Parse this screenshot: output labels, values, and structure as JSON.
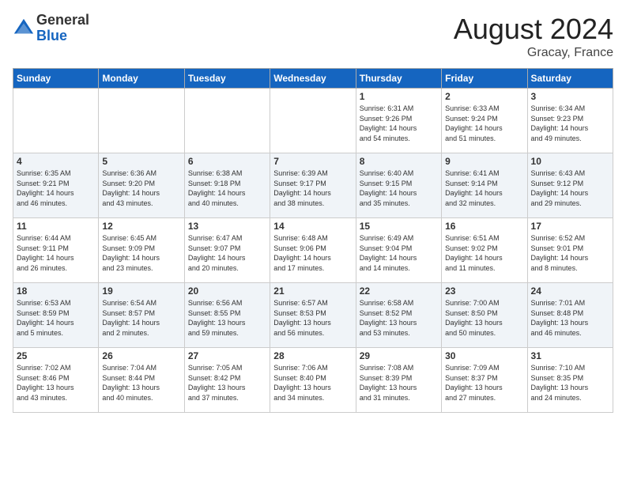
{
  "header": {
    "logo_general": "General",
    "logo_blue": "Blue",
    "month_title": "August 2024",
    "location": "Gracay, France"
  },
  "days_of_week": [
    "Sunday",
    "Monday",
    "Tuesday",
    "Wednesday",
    "Thursday",
    "Friday",
    "Saturday"
  ],
  "weeks": [
    {
      "days": [
        {
          "num": "",
          "info": ""
        },
        {
          "num": "",
          "info": ""
        },
        {
          "num": "",
          "info": ""
        },
        {
          "num": "",
          "info": ""
        },
        {
          "num": "1",
          "info": "Sunrise: 6:31 AM\nSunset: 9:26 PM\nDaylight: 14 hours\nand 54 minutes."
        },
        {
          "num": "2",
          "info": "Sunrise: 6:33 AM\nSunset: 9:24 PM\nDaylight: 14 hours\nand 51 minutes."
        },
        {
          "num": "3",
          "info": "Sunrise: 6:34 AM\nSunset: 9:23 PM\nDaylight: 14 hours\nand 49 minutes."
        }
      ]
    },
    {
      "days": [
        {
          "num": "4",
          "info": "Sunrise: 6:35 AM\nSunset: 9:21 PM\nDaylight: 14 hours\nand 46 minutes."
        },
        {
          "num": "5",
          "info": "Sunrise: 6:36 AM\nSunset: 9:20 PM\nDaylight: 14 hours\nand 43 minutes."
        },
        {
          "num": "6",
          "info": "Sunrise: 6:38 AM\nSunset: 9:18 PM\nDaylight: 14 hours\nand 40 minutes."
        },
        {
          "num": "7",
          "info": "Sunrise: 6:39 AM\nSunset: 9:17 PM\nDaylight: 14 hours\nand 38 minutes."
        },
        {
          "num": "8",
          "info": "Sunrise: 6:40 AM\nSunset: 9:15 PM\nDaylight: 14 hours\nand 35 minutes."
        },
        {
          "num": "9",
          "info": "Sunrise: 6:41 AM\nSunset: 9:14 PM\nDaylight: 14 hours\nand 32 minutes."
        },
        {
          "num": "10",
          "info": "Sunrise: 6:43 AM\nSunset: 9:12 PM\nDaylight: 14 hours\nand 29 minutes."
        }
      ]
    },
    {
      "days": [
        {
          "num": "11",
          "info": "Sunrise: 6:44 AM\nSunset: 9:11 PM\nDaylight: 14 hours\nand 26 minutes."
        },
        {
          "num": "12",
          "info": "Sunrise: 6:45 AM\nSunset: 9:09 PM\nDaylight: 14 hours\nand 23 minutes."
        },
        {
          "num": "13",
          "info": "Sunrise: 6:47 AM\nSunset: 9:07 PM\nDaylight: 14 hours\nand 20 minutes."
        },
        {
          "num": "14",
          "info": "Sunrise: 6:48 AM\nSunset: 9:06 PM\nDaylight: 14 hours\nand 17 minutes."
        },
        {
          "num": "15",
          "info": "Sunrise: 6:49 AM\nSunset: 9:04 PM\nDaylight: 14 hours\nand 14 minutes."
        },
        {
          "num": "16",
          "info": "Sunrise: 6:51 AM\nSunset: 9:02 PM\nDaylight: 14 hours\nand 11 minutes."
        },
        {
          "num": "17",
          "info": "Sunrise: 6:52 AM\nSunset: 9:01 PM\nDaylight: 14 hours\nand 8 minutes."
        }
      ]
    },
    {
      "days": [
        {
          "num": "18",
          "info": "Sunrise: 6:53 AM\nSunset: 8:59 PM\nDaylight: 14 hours\nand 5 minutes."
        },
        {
          "num": "19",
          "info": "Sunrise: 6:54 AM\nSunset: 8:57 PM\nDaylight: 14 hours\nand 2 minutes."
        },
        {
          "num": "20",
          "info": "Sunrise: 6:56 AM\nSunset: 8:55 PM\nDaylight: 13 hours\nand 59 minutes."
        },
        {
          "num": "21",
          "info": "Sunrise: 6:57 AM\nSunset: 8:53 PM\nDaylight: 13 hours\nand 56 minutes."
        },
        {
          "num": "22",
          "info": "Sunrise: 6:58 AM\nSunset: 8:52 PM\nDaylight: 13 hours\nand 53 minutes."
        },
        {
          "num": "23",
          "info": "Sunrise: 7:00 AM\nSunset: 8:50 PM\nDaylight: 13 hours\nand 50 minutes."
        },
        {
          "num": "24",
          "info": "Sunrise: 7:01 AM\nSunset: 8:48 PM\nDaylight: 13 hours\nand 46 minutes."
        }
      ]
    },
    {
      "days": [
        {
          "num": "25",
          "info": "Sunrise: 7:02 AM\nSunset: 8:46 PM\nDaylight: 13 hours\nand 43 minutes."
        },
        {
          "num": "26",
          "info": "Sunrise: 7:04 AM\nSunset: 8:44 PM\nDaylight: 13 hours\nand 40 minutes."
        },
        {
          "num": "27",
          "info": "Sunrise: 7:05 AM\nSunset: 8:42 PM\nDaylight: 13 hours\nand 37 minutes."
        },
        {
          "num": "28",
          "info": "Sunrise: 7:06 AM\nSunset: 8:40 PM\nDaylight: 13 hours\nand 34 minutes."
        },
        {
          "num": "29",
          "info": "Sunrise: 7:08 AM\nSunset: 8:39 PM\nDaylight: 13 hours\nand 31 minutes."
        },
        {
          "num": "30",
          "info": "Sunrise: 7:09 AM\nSunset: 8:37 PM\nDaylight: 13 hours\nand 27 minutes."
        },
        {
          "num": "31",
          "info": "Sunrise: 7:10 AM\nSunset: 8:35 PM\nDaylight: 13 hours\nand 24 minutes."
        }
      ]
    }
  ]
}
